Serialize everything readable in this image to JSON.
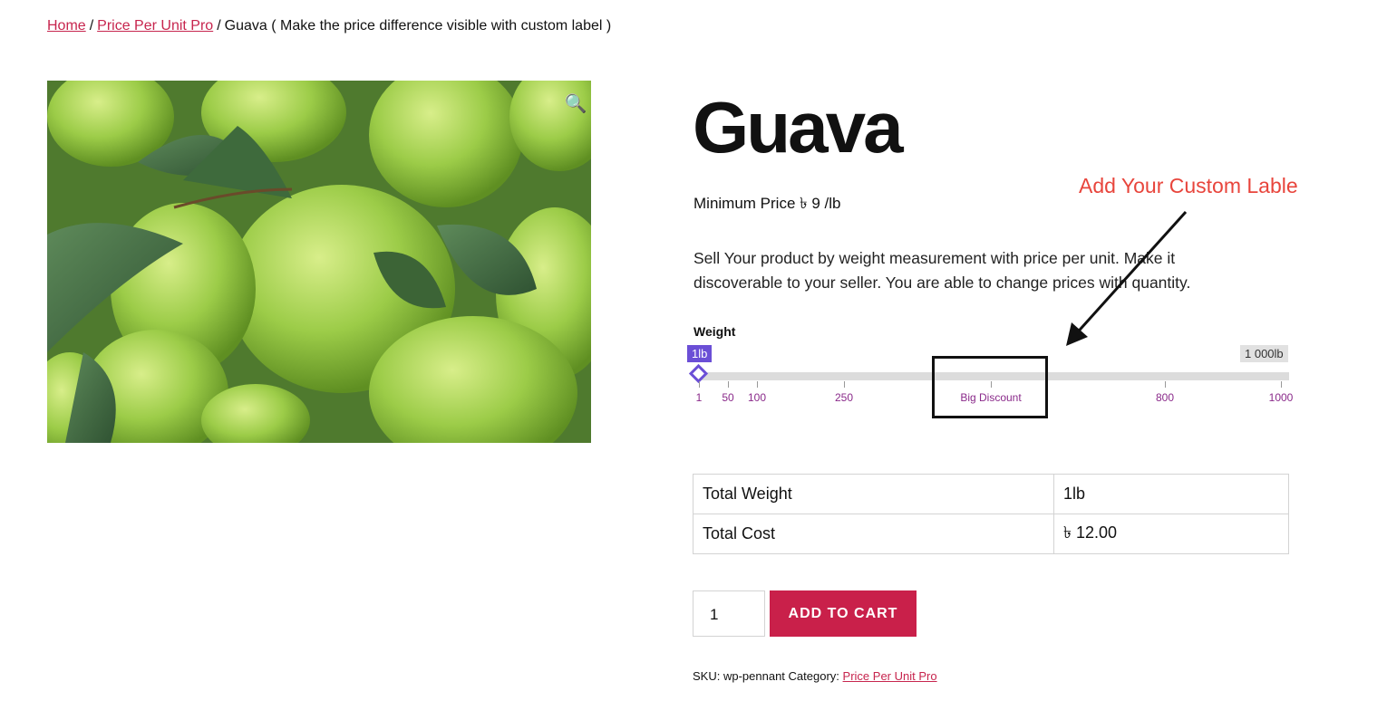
{
  "breadcrumb": {
    "home": "Home",
    "separator": "/",
    "category": "Price Per Unit Pro",
    "current": "Guava ( Make the price difference visible with custom label )"
  },
  "product": {
    "title": "Guava",
    "min_price": "Minimum Price ৳ 9 /lb",
    "description": "Sell Your product by weight measurement with price per unit. Make it discoverable to your seller. You are able to change prices with quantity.",
    "image_icon": "zoom-icon"
  },
  "annotation": {
    "custom_label_note": "Add Your Custom Lable"
  },
  "slider": {
    "label": "Weight",
    "min_badge": "1lb",
    "max_badge": "1 000lb",
    "value_fraction": 0,
    "ticks": [
      {
        "label": "1"
      },
      {
        "label": "50"
      },
      {
        "label": "100"
      },
      {
        "label": "250"
      },
      {
        "label": "Big Discount"
      },
      {
        "label": "800"
      },
      {
        "label": "1000"
      }
    ]
  },
  "totals": {
    "rows": [
      {
        "label": "Total Weight",
        "value": "1lb"
      },
      {
        "label": "Total Cost",
        "value": "৳ 12.00"
      }
    ]
  },
  "cart": {
    "quantity": "1",
    "add_button": "ADD TO CART"
  },
  "meta": {
    "sku_label": "SKU:",
    "sku_value": "wp-pennant",
    "category_label": "Category:",
    "category_value": "Price Per Unit Pro"
  },
  "colors": {
    "link": "#c7254e",
    "accent_purple": "#6b4fd6",
    "button": "#c9204a",
    "annotation": "#e8453c"
  }
}
